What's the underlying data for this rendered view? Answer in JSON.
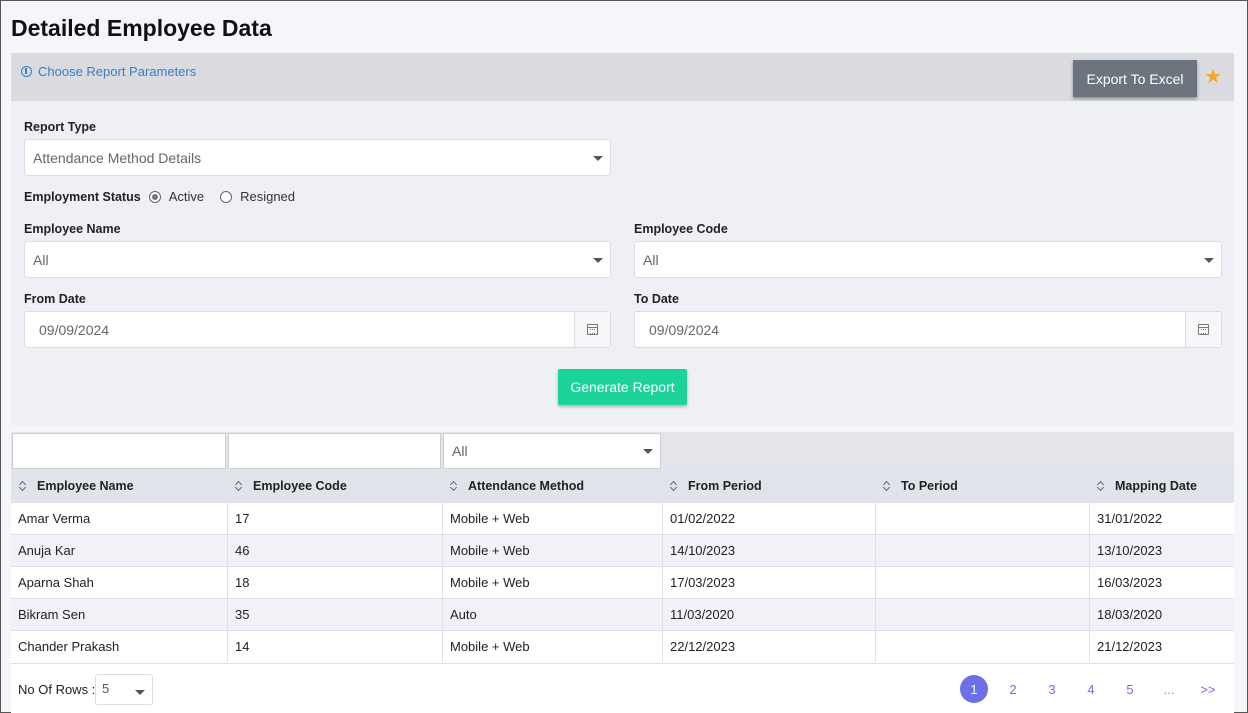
{
  "page": {
    "title": "Detailed Employee Data"
  },
  "params": {
    "link_label": "Choose Report Parameters",
    "export_label": "Export To Excel",
    "accent_star_color": "#f5a623"
  },
  "form": {
    "report_type_label": "Report Type",
    "report_type_value": "Attendance Method Details",
    "employment_status_label": "Employment Status",
    "status_options": [
      "Active",
      "Resigned"
    ],
    "status_selected": "Active",
    "employee_name_label": "Employee Name",
    "employee_name_value": "All",
    "employee_code_label": "Employee Code",
    "employee_code_value": "All",
    "from_date_label": "From Date",
    "from_date_value": "09/09/2024",
    "to_date_label": "To Date",
    "to_date_value": "09/09/2024",
    "generate_label": "Generate Report",
    "generate_color": "#1dd39c"
  },
  "table": {
    "filter_method_value": "All",
    "columns": [
      "Employee Name",
      "Employee Code",
      "Attendance Method",
      "From Period",
      "To Period",
      "Mapping Date"
    ],
    "rows": [
      [
        "Amar Verma",
        "17",
        "Mobile + Web",
        "01/02/2022",
        "",
        "31/01/2022"
      ],
      [
        "Anuja Kar",
        "46",
        "Mobile + Web",
        "14/10/2023",
        "",
        "13/10/2023"
      ],
      [
        "Aparna Shah",
        "18",
        "Mobile + Web",
        "17/03/2023",
        "",
        "16/03/2023"
      ],
      [
        "Bikram Sen",
        "35",
        "Auto",
        "11/03/2020",
        "",
        "18/03/2020"
      ],
      [
        "Chander Prakash",
        "14",
        "Mobile + Web",
        "22/12/2023",
        "",
        "21/12/2023"
      ]
    ]
  },
  "footer": {
    "rows_label": "No Of Rows :",
    "rows_value": "5",
    "pages": [
      "1",
      "2",
      "3",
      "4",
      "5",
      "...",
      ">>"
    ],
    "active_page": "1"
  }
}
